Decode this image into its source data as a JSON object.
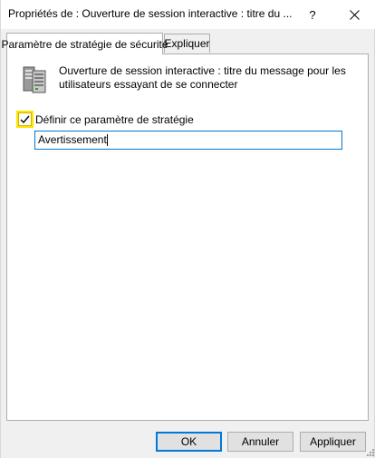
{
  "window": {
    "title": "Propriétés de : Ouverture de session interactive : titre du ...",
    "help_label": "?"
  },
  "tabs": [
    {
      "label": "Paramètre de stratégie de sécurité",
      "active": true
    },
    {
      "label": "Expliquer",
      "active": false
    }
  ],
  "policy": {
    "icon": "server-policy-icon",
    "description": "Ouverture de session interactive : titre du message pour les utilisateurs essayant de se connecter",
    "checkbox_label": "Définir ce paramètre de stratégie",
    "checkbox_checked": true,
    "input_value": "Avertissement"
  },
  "buttons": {
    "ok": "OK",
    "cancel": "Annuler",
    "apply": "Appliquer"
  },
  "colors": {
    "focus_border": "#0078d7",
    "checkbox_highlight": "#ffe500",
    "dialog_bg": "#f0f0f0"
  }
}
